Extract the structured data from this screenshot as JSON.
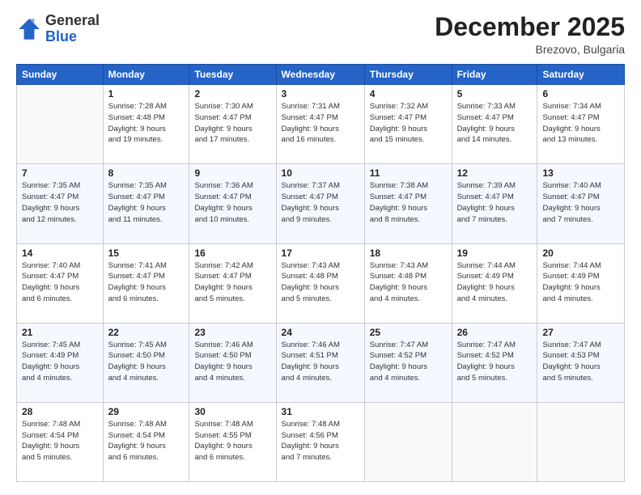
{
  "logo": {
    "general": "General",
    "blue": "Blue"
  },
  "title": "December 2025",
  "location": "Brezovo, Bulgaria",
  "days_of_week": [
    "Sunday",
    "Monday",
    "Tuesday",
    "Wednesday",
    "Thursday",
    "Friday",
    "Saturday"
  ],
  "weeks": [
    [
      {
        "day": "",
        "info": ""
      },
      {
        "day": "1",
        "info": "Sunrise: 7:28 AM\nSunset: 4:48 PM\nDaylight: 9 hours\nand 19 minutes."
      },
      {
        "day": "2",
        "info": "Sunrise: 7:30 AM\nSunset: 4:47 PM\nDaylight: 9 hours\nand 17 minutes."
      },
      {
        "day": "3",
        "info": "Sunrise: 7:31 AM\nSunset: 4:47 PM\nDaylight: 9 hours\nand 16 minutes."
      },
      {
        "day": "4",
        "info": "Sunrise: 7:32 AM\nSunset: 4:47 PM\nDaylight: 9 hours\nand 15 minutes."
      },
      {
        "day": "5",
        "info": "Sunrise: 7:33 AM\nSunset: 4:47 PM\nDaylight: 9 hours\nand 14 minutes."
      },
      {
        "day": "6",
        "info": "Sunrise: 7:34 AM\nSunset: 4:47 PM\nDaylight: 9 hours\nand 13 minutes."
      }
    ],
    [
      {
        "day": "7",
        "info": "Sunrise: 7:35 AM\nSunset: 4:47 PM\nDaylight: 9 hours\nand 12 minutes."
      },
      {
        "day": "8",
        "info": "Sunrise: 7:35 AM\nSunset: 4:47 PM\nDaylight: 9 hours\nand 11 minutes."
      },
      {
        "day": "9",
        "info": "Sunrise: 7:36 AM\nSunset: 4:47 PM\nDaylight: 9 hours\nand 10 minutes."
      },
      {
        "day": "10",
        "info": "Sunrise: 7:37 AM\nSunset: 4:47 PM\nDaylight: 9 hours\nand 9 minutes."
      },
      {
        "day": "11",
        "info": "Sunrise: 7:38 AM\nSunset: 4:47 PM\nDaylight: 9 hours\nand 8 minutes."
      },
      {
        "day": "12",
        "info": "Sunrise: 7:39 AM\nSunset: 4:47 PM\nDaylight: 9 hours\nand 7 minutes."
      },
      {
        "day": "13",
        "info": "Sunrise: 7:40 AM\nSunset: 4:47 PM\nDaylight: 9 hours\nand 7 minutes."
      }
    ],
    [
      {
        "day": "14",
        "info": "Sunrise: 7:40 AM\nSunset: 4:47 PM\nDaylight: 9 hours\nand 6 minutes."
      },
      {
        "day": "15",
        "info": "Sunrise: 7:41 AM\nSunset: 4:47 PM\nDaylight: 9 hours\nand 6 minutes."
      },
      {
        "day": "16",
        "info": "Sunrise: 7:42 AM\nSunset: 4:47 PM\nDaylight: 9 hours\nand 5 minutes."
      },
      {
        "day": "17",
        "info": "Sunrise: 7:43 AM\nSunset: 4:48 PM\nDaylight: 9 hours\nand 5 minutes."
      },
      {
        "day": "18",
        "info": "Sunrise: 7:43 AM\nSunset: 4:48 PM\nDaylight: 9 hours\nand 4 minutes."
      },
      {
        "day": "19",
        "info": "Sunrise: 7:44 AM\nSunset: 4:49 PM\nDaylight: 9 hours\nand 4 minutes."
      },
      {
        "day": "20",
        "info": "Sunrise: 7:44 AM\nSunset: 4:49 PM\nDaylight: 9 hours\nand 4 minutes."
      }
    ],
    [
      {
        "day": "21",
        "info": "Sunrise: 7:45 AM\nSunset: 4:49 PM\nDaylight: 9 hours\nand 4 minutes."
      },
      {
        "day": "22",
        "info": "Sunrise: 7:45 AM\nSunset: 4:50 PM\nDaylight: 9 hours\nand 4 minutes."
      },
      {
        "day": "23",
        "info": "Sunrise: 7:46 AM\nSunset: 4:50 PM\nDaylight: 9 hours\nand 4 minutes."
      },
      {
        "day": "24",
        "info": "Sunrise: 7:46 AM\nSunset: 4:51 PM\nDaylight: 9 hours\nand 4 minutes."
      },
      {
        "day": "25",
        "info": "Sunrise: 7:47 AM\nSunset: 4:52 PM\nDaylight: 9 hours\nand 4 minutes."
      },
      {
        "day": "26",
        "info": "Sunrise: 7:47 AM\nSunset: 4:52 PM\nDaylight: 9 hours\nand 5 minutes."
      },
      {
        "day": "27",
        "info": "Sunrise: 7:47 AM\nSunset: 4:53 PM\nDaylight: 9 hours\nand 5 minutes."
      }
    ],
    [
      {
        "day": "28",
        "info": "Sunrise: 7:48 AM\nSunset: 4:54 PM\nDaylight: 9 hours\nand 5 minutes."
      },
      {
        "day": "29",
        "info": "Sunrise: 7:48 AM\nSunset: 4:54 PM\nDaylight: 9 hours\nand 6 minutes."
      },
      {
        "day": "30",
        "info": "Sunrise: 7:48 AM\nSunset: 4:55 PM\nDaylight: 9 hours\nand 6 minutes."
      },
      {
        "day": "31",
        "info": "Sunrise: 7:48 AM\nSunset: 4:56 PM\nDaylight: 9 hours\nand 7 minutes."
      },
      {
        "day": "",
        "info": ""
      },
      {
        "day": "",
        "info": ""
      },
      {
        "day": "",
        "info": ""
      }
    ]
  ]
}
